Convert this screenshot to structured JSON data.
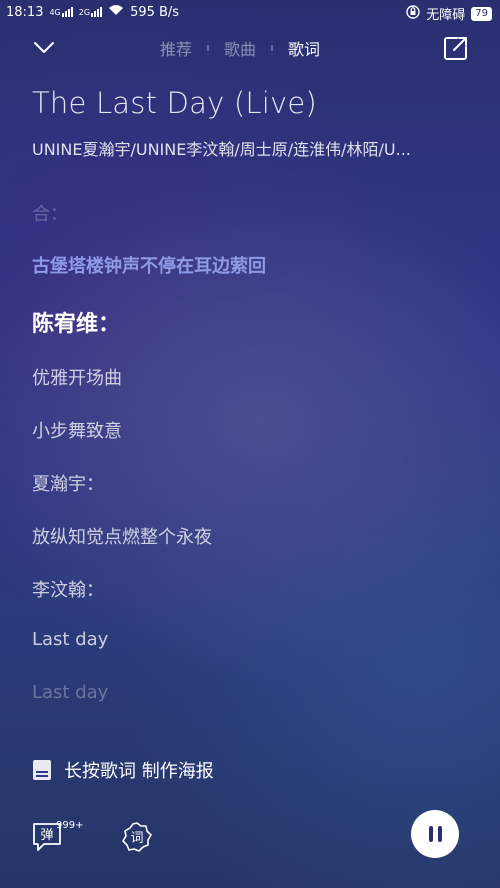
{
  "status_bar": {
    "time": "18:13",
    "signal1": "4G",
    "signal2": "2G",
    "speed": "595 B/s",
    "accessibility": "无障碍",
    "battery": "79"
  },
  "tabs": [
    {
      "label": "推荐",
      "active": false
    },
    {
      "label": "歌曲",
      "active": false
    },
    {
      "label": "歌词",
      "active": true
    }
  ],
  "song": {
    "title": "The Last Day (Live)",
    "artists": "UNINE夏瀚宇/UNINE李汶翰/周士原/连淮伟/林陌/U..."
  },
  "lyrics": [
    {
      "text": "合：",
      "style": "faint"
    },
    {
      "text": "古堡塔楼钟声不停在耳边萦回",
      "style": "highlight"
    },
    {
      "text": "陈宥维：",
      "style": "current"
    },
    {
      "text": "优雅开场曲",
      "style": "normal"
    },
    {
      "text": "小步舞致意",
      "style": "normal"
    },
    {
      "text": "夏瀚宇：",
      "style": "normal"
    },
    {
      "text": "放纵知觉点燃整个永夜",
      "style": "normal"
    },
    {
      "text": "李汶翰：",
      "style": "normal"
    },
    {
      "text": "Last day",
      "style": "normal"
    },
    {
      "text": "Last day",
      "style": "fade"
    }
  ],
  "poster": {
    "label": "长按歌词 制作海报"
  },
  "controls": {
    "danmu_label": "弹",
    "danmu_count": "999+",
    "lyric_label": "词"
  },
  "icons": {
    "collapse": "chevron-down-icon",
    "share": "share-external-icon",
    "poster": "poster-icon",
    "pause": "pause-icon"
  }
}
